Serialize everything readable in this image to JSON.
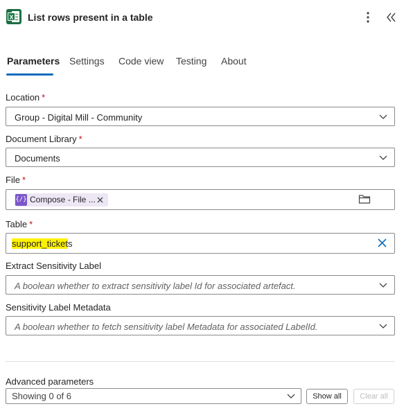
{
  "header": {
    "title": "List rows present in a table",
    "app_icon": "excel-icon",
    "more_icon": "more-vertical-icon",
    "collapse_icon": "double-chevron-left-icon"
  },
  "tabs": [
    {
      "label": "Parameters",
      "active": true
    },
    {
      "label": "Settings",
      "active": false
    },
    {
      "label": "Code view",
      "active": false
    },
    {
      "label": "Testing",
      "active": false
    },
    {
      "label": "About",
      "active": false
    }
  ],
  "fields": {
    "location": {
      "label": "Location",
      "required": "*",
      "value": "Group - Digital Mill - Community"
    },
    "document_library": {
      "label": "Document Library",
      "required": "*",
      "value": "Documents"
    },
    "file": {
      "label": "File",
      "required": "*",
      "token_label": "Compose - File ...",
      "token_icon": "{/}"
    },
    "table": {
      "label": "Table",
      "required": "*",
      "value_highlighted": "support_ticket",
      "value_rest": "s"
    },
    "extract_sensitivity": {
      "label": "Extract Sensitivity Label",
      "placeholder": "A boolean whether to extract sensitivity label Id for associated artefact."
    },
    "sensitivity_metadata": {
      "label": "Sensitivity Label Metadata",
      "placeholder": "A boolean whether to fetch sensitivity label Metadata for associated LabelId."
    }
  },
  "advanced": {
    "label": "Advanced parameters",
    "select_value": "Showing 0 of 6",
    "show_all": "Show all",
    "clear_all": "Clear all"
  },
  "colors": {
    "accent": "#0f6cbd",
    "required": "#c50f1f",
    "highlight": "#fff200",
    "token_bg": "#ece6f5",
    "token_icon": "#7b57c9",
    "excel_green": "#1d6f42"
  }
}
